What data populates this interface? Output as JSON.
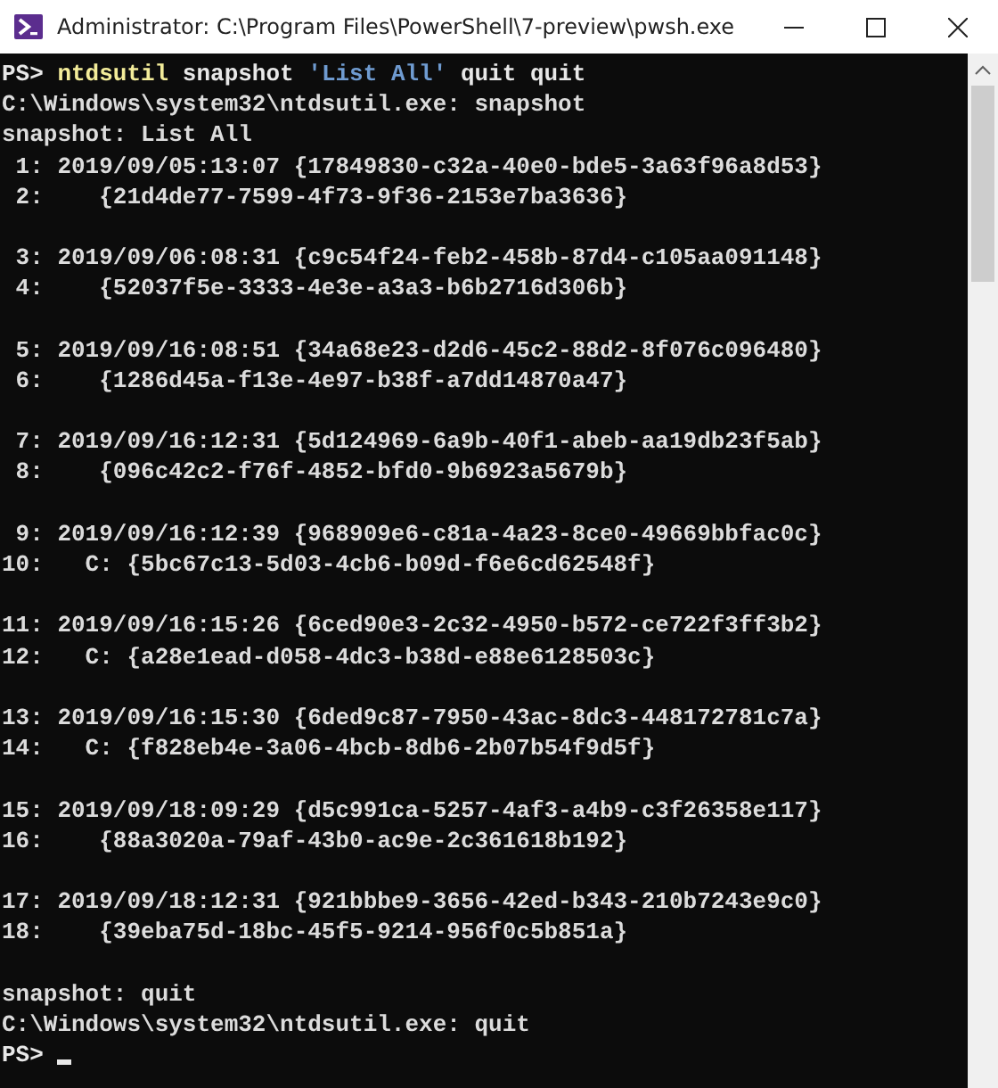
{
  "window": {
    "title": "Administrator: C:\\Program Files\\PowerShell\\7-preview\\pwsh.exe"
  },
  "lines": [
    {
      "kind": "input",
      "segments": [
        {
          "kind": "prompt",
          "text": "PS>"
        },
        {
          "kind": "command",
          "text": "ntdsutil"
        },
        {
          "kind": "argument",
          "text": "snapshot"
        },
        {
          "kind": "string",
          "text": "'List All'"
        },
        {
          "kind": "argument",
          "text": "quit"
        },
        {
          "kind": "argument",
          "text": "quit"
        }
      ]
    },
    {
      "kind": "output",
      "text": "C:\\Windows\\system32\\ntdsutil.exe: snapshot"
    },
    {
      "kind": "output",
      "text": "snapshot: List All"
    },
    {
      "kind": "output",
      "text": " 1: 2019/09/05:13:07 {17849830-c32a-40e0-bde5-3a63f96a8d53}"
    },
    {
      "kind": "output",
      "text": " 2:    {21d4de77-7599-4f73-9f36-2153e7ba3636}"
    },
    {
      "kind": "blank"
    },
    {
      "kind": "output",
      "text": " 3: 2019/09/06:08:31 {c9c54f24-feb2-458b-87d4-c105aa091148}"
    },
    {
      "kind": "output",
      "text": " 4:    {52037f5e-3333-4e3e-a3a3-b6b2716d306b}"
    },
    {
      "kind": "blank"
    },
    {
      "kind": "output",
      "text": " 5: 2019/09/16:08:51 {34a68e23-d2d6-45c2-88d2-8f076c096480}"
    },
    {
      "kind": "output",
      "text": " 6:    {1286d45a-f13e-4e97-b38f-a7dd14870a47}"
    },
    {
      "kind": "blank"
    },
    {
      "kind": "output",
      "text": " 7: 2019/09/16:12:31 {5d124969-6a9b-40f1-abeb-aa19db23f5ab}"
    },
    {
      "kind": "output",
      "text": " 8:    {096c42c2-f76f-4852-bfd0-9b6923a5679b}"
    },
    {
      "kind": "blank"
    },
    {
      "kind": "output",
      "text": " 9: 2019/09/16:12:39 {968909e6-c81a-4a23-8ce0-49669bbfac0c}"
    },
    {
      "kind": "output",
      "text": "10:   C: {5bc67c13-5d03-4cb6-b09d-f6e6cd62548f}"
    },
    {
      "kind": "blank"
    },
    {
      "kind": "output",
      "text": "11: 2019/09/16:15:26 {6ced90e3-2c32-4950-b572-ce722f3ff3b2}"
    },
    {
      "kind": "output",
      "text": "12:   C: {a28e1ead-d058-4dc3-b38d-e88e6128503c}"
    },
    {
      "kind": "blank"
    },
    {
      "kind": "output",
      "text": "13: 2019/09/16:15:30 {6ded9c87-7950-43ac-8dc3-448172781c7a}"
    },
    {
      "kind": "output",
      "text": "14:   C: {f828eb4e-3a06-4bcb-8db6-2b07b54f9d5f}"
    },
    {
      "kind": "blank"
    },
    {
      "kind": "output",
      "text": "15: 2019/09/18:09:29 {d5c991ca-5257-4af3-a4b9-c3f26358e117}"
    },
    {
      "kind": "output",
      "text": "16:    {88a3020a-79af-43b0-ac9e-2c361618b192}"
    },
    {
      "kind": "blank"
    },
    {
      "kind": "output",
      "text": "17: 2019/09/18:12:31 {921bbbe9-3656-42ed-b343-210b7243e9c0}"
    },
    {
      "kind": "output",
      "text": "18:    {39eba75d-18bc-45f5-9214-956f0c5b851a}"
    },
    {
      "kind": "blank"
    },
    {
      "kind": "output",
      "text": "snapshot: quit"
    },
    {
      "kind": "output",
      "text": "C:\\Windows\\system32\\ntdsutil.exe: quit"
    },
    {
      "kind": "input",
      "segments": [
        {
          "kind": "prompt",
          "text": "PS>"
        },
        {
          "kind": "cursor"
        }
      ]
    }
  ]
}
